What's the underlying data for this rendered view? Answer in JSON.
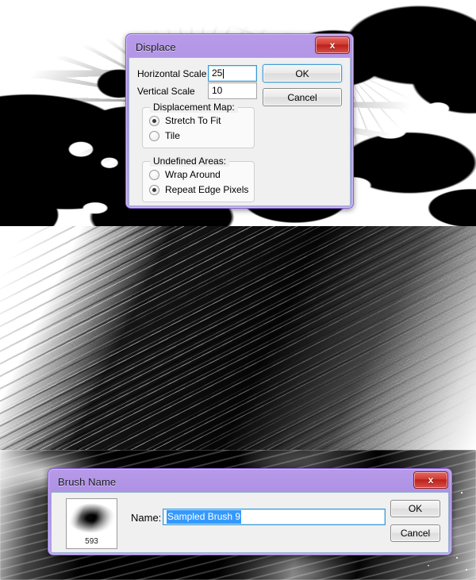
{
  "app": {
    "context": "photoshop-brush-creation-tutorial"
  },
  "panels": [
    {
      "name": "high-contrast-cloud-texture",
      "caption": ""
    },
    {
      "name": "displaced-smudge-texture",
      "caption": ""
    },
    {
      "name": "smoky-brush-stroke-texture",
      "caption": ""
    }
  ],
  "displace_dialog": {
    "title": "Displace",
    "close_label": "x",
    "fields": [
      {
        "label": "Horizontal Scale",
        "value": "25",
        "focused": true
      },
      {
        "label": "Vertical Scale",
        "value": "10",
        "focused": false
      }
    ],
    "groups": [
      {
        "title": "Displacement Map:",
        "options": [
          {
            "label": "Stretch To Fit",
            "selected": true
          },
          {
            "label": "Tile",
            "selected": false
          }
        ]
      },
      {
        "title": "Undefined Areas:",
        "options": [
          {
            "label": "Wrap Around",
            "selected": false
          },
          {
            "label": "Repeat Edge Pixels",
            "selected": true
          }
        ]
      }
    ],
    "buttons": {
      "ok": "OK",
      "cancel": "Cancel"
    }
  },
  "brush_dialog": {
    "title": "Brush Name",
    "close_label": "x",
    "preview": {
      "size_label": "593"
    },
    "name_label": "Name:",
    "name_value": "Sampled Brush 9",
    "name_selected": true,
    "buttons": {
      "ok": "OK",
      "cancel": "Cancel"
    }
  },
  "colors": {
    "titlebar_purple": "#b79ae8",
    "dialog_border": "#8860d8",
    "close_red": "#ba2018",
    "focus_blue": "#3c9ad6",
    "selection_blue": "#3399ff",
    "dialog_face": "#f0f0f0"
  }
}
